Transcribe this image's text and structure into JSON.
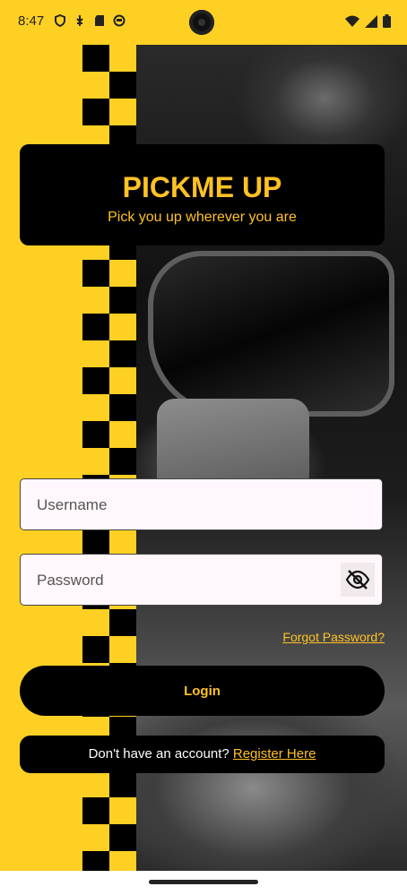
{
  "status_bar": {
    "time": "8:47",
    "left_icons": [
      "shield-icon",
      "usb-icon",
      "sd-card-icon",
      "app-icon"
    ],
    "right_icons": [
      "wifi-icon",
      "signal-icon",
      "battery-icon"
    ]
  },
  "header": {
    "title": "PICKME UP",
    "subtitle": "Pick you up wherever you are"
  },
  "form": {
    "username_placeholder": "Username",
    "password_placeholder": "Password",
    "visibility_icon": "eye-off-icon",
    "forgot_label": "Forgot Password?",
    "login_label": "Login"
  },
  "register": {
    "prompt": "Don't have an account? ",
    "link_label": "Register Here"
  },
  "colors": {
    "accent": "#ffc225",
    "strip": "#ffd024",
    "card": "#000000"
  }
}
